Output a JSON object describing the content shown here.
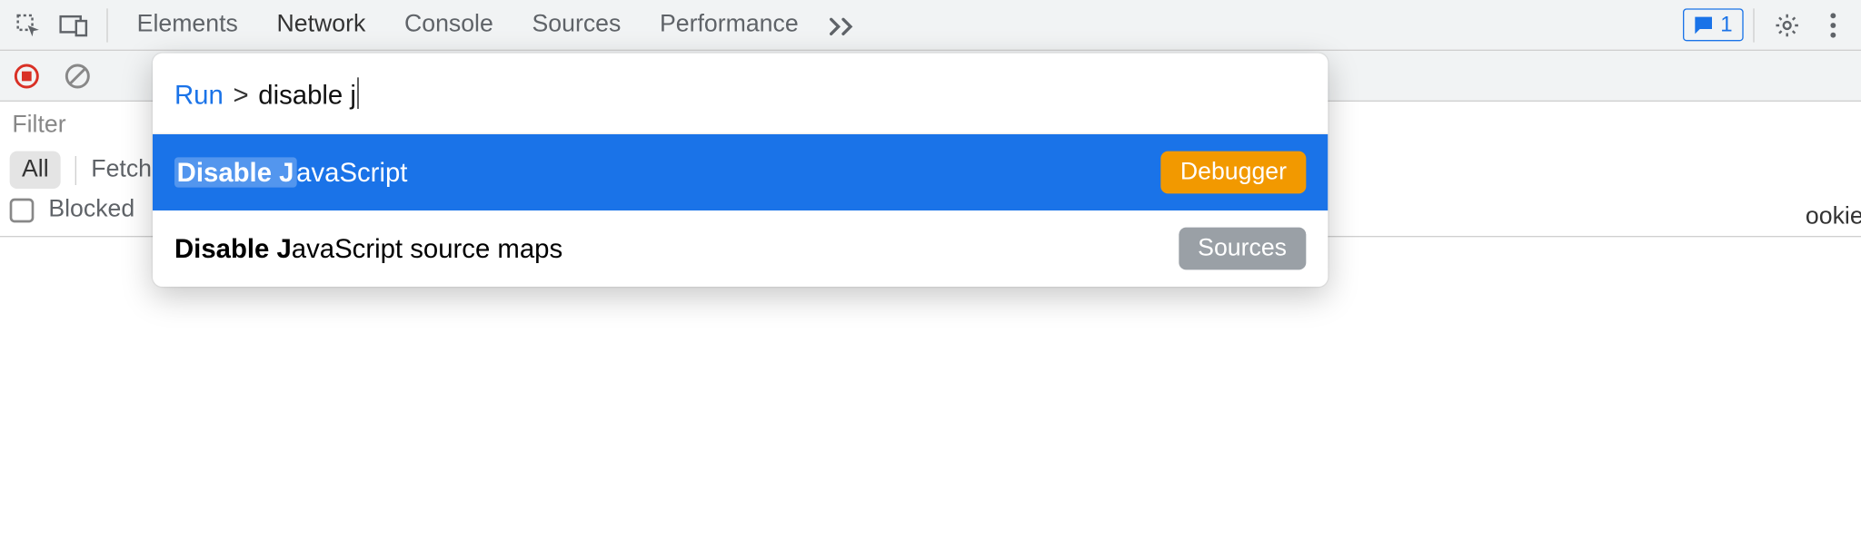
{
  "tabs": {
    "elements": "Elements",
    "network": "Network",
    "console": "Console",
    "sources": "Sources",
    "performance": "Performance",
    "active": "Network"
  },
  "issues": {
    "count": "1"
  },
  "filter": {
    "placeholder": "Filter",
    "chip_all": "All",
    "chip_fetch": "Fetch",
    "blocked_label": "Blocked",
    "cookie_tail": "ookie"
  },
  "palette": {
    "run": "Run",
    "chevron": ">",
    "query": "disable j",
    "results": [
      {
        "bold": "Disable J",
        "rest": "avaScript",
        "category": "Debugger"
      },
      {
        "bold": "Disable J",
        "rest": "avaScript source maps",
        "category": "Sources"
      }
    ]
  }
}
